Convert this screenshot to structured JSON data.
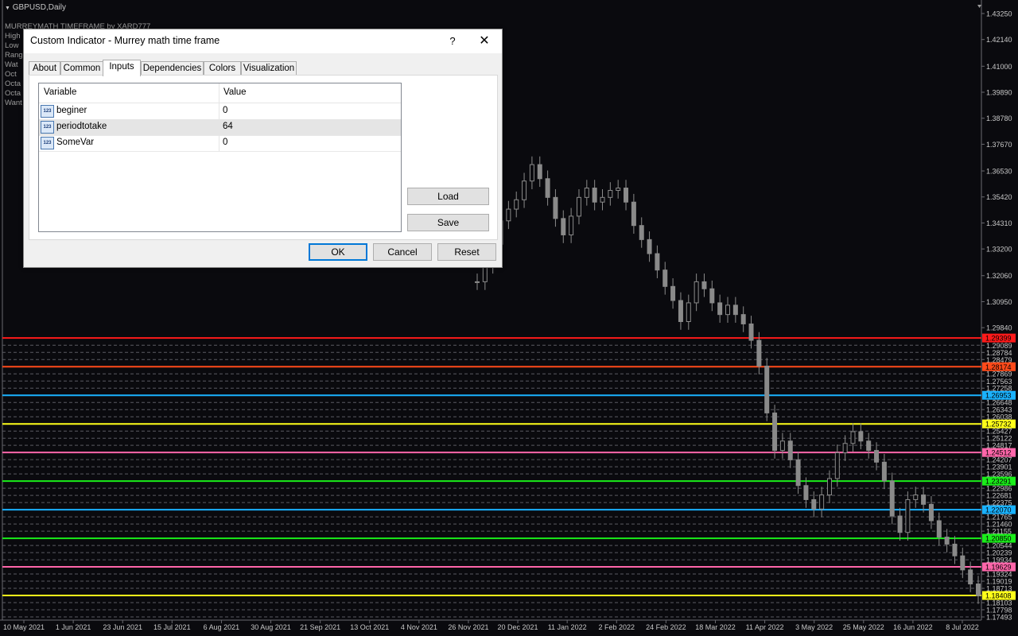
{
  "chart": {
    "title": "GBPUSD,Daily",
    "indicator_labels": [
      "MURREYMATH TIMEFRAME by XARD777",
      "High",
      "Low",
      "Range",
      "Wat",
      "Oct",
      "Octa",
      "Octa",
      "Want"
    ],
    "price_labels": [
      "1.43250",
      "1.42140",
      "1.41000",
      "1.39890",
      "1.38780",
      "1.37670",
      "1.36530",
      "1.35420",
      "1.34310",
      "1.33200",
      "1.32060",
      "1.30950",
      "1.29840",
      "1.29089",
      "1.28784",
      "1.28479",
      "1.27869",
      "1.27563",
      "1.27258",
      "1.26648",
      "1.26343",
      "1.26038",
      "1.25427",
      "1.25122",
      "1.24817",
      "1.24207",
      "1.23901",
      "1.23596",
      "1.22986",
      "1.22681",
      "1.22375",
      "1.21765",
      "1.21460",
      "1.21155",
      "1.20544",
      "1.20239",
      "1.19934",
      "1.19324",
      "1.19019",
      "1.18713",
      "1.18103",
      "1.17798",
      "1.17493"
    ],
    "level_labels": [
      {
        "value": "1.29399",
        "color": "#ff1a1a"
      },
      {
        "value": "1.28174",
        "color": "#ff4a1a"
      },
      {
        "value": "1.26953",
        "color": "#1ab2ff"
      },
      {
        "value": "1.25732",
        "color": "#ffff1a"
      },
      {
        "value": "1.24512",
        "color": "#ff66aa"
      },
      {
        "value": "1.23291",
        "color": "#1aee1a"
      },
      {
        "value": "1.22070",
        "color": "#1ab2ff"
      },
      {
        "value": "1.20850",
        "color": "#1aee1a"
      },
      {
        "value": "1.19629",
        "color": "#ff66aa"
      },
      {
        "value": "1.18408",
        "color": "#ffff1a"
      }
    ],
    "date_labels": [
      "10 May 2021",
      "1 Jun 2021",
      "23 Jun 2021",
      "15 Jul 2021",
      "6 Aug 2021",
      "30 Aug 2021",
      "21 Sep 2021",
      "13 Oct 2021",
      "4 Nov 2021",
      "26 Nov 2021",
      "20 Dec 2021",
      "11 Jan 2022",
      "2 Feb 2022",
      "24 Feb 2022",
      "18 Mar 2022",
      "11 Apr 2022",
      "3 May 2022",
      "25 May 2022",
      "16 Jun 2022",
      "8 Jul 2022"
    ],
    "price_series": [
      1.318,
      1.325,
      1.334,
      1.344,
      1.349,
      1.353,
      1.361,
      1.368,
      1.362,
      1.354,
      1.345,
      1.338,
      1.346,
      1.354,
      1.358,
      1.352,
      1.354,
      1.357,
      1.358,
      1.352,
      1.342,
      1.336,
      1.33,
      1.323,
      1.316,
      1.31,
      1.301,
      1.309,
      1.318,
      1.315,
      1.309,
      1.304,
      1.308,
      1.304,
      1.3,
      1.293,
      1.282,
      1.262,
      1.246,
      1.25,
      1.242,
      1.231,
      1.225,
      1.221,
      1.227,
      1.234,
      1.245,
      1.249,
      1.254,
      1.25,
      1.246,
      1.241,
      1.233,
      1.218,
      1.211,
      1.225,
      1.227,
      1.223,
      1.216,
      1.209,
      1.206,
      1.201,
      1.195,
      1.189,
      1.184
    ],
    "colors": {
      "background": "#0a0a0e",
      "candle": "#8a8a8a",
      "dashed": "#5a5a62"
    }
  },
  "dialog": {
    "title": "Custom Indicator - Murrey math time frame",
    "help_label": "?",
    "close_label": "✕",
    "tabs": [
      {
        "label": "About",
        "active": false
      },
      {
        "label": "Common",
        "active": false
      },
      {
        "label": "Inputs",
        "active": true
      },
      {
        "label": "Dependencies",
        "active": false
      },
      {
        "label": "Colors",
        "active": false
      },
      {
        "label": "Visualization",
        "active": false
      }
    ],
    "grid": {
      "col_variable": "Variable",
      "col_value": "Value",
      "rows": [
        {
          "icon": "123",
          "name": "beginer",
          "value": "0",
          "selected": false
        },
        {
          "icon": "123",
          "name": "periodtotake",
          "value": "64",
          "selected": true
        },
        {
          "icon": "123",
          "name": "SomeVar",
          "value": "0",
          "selected": false
        }
      ]
    },
    "load_label": "Load",
    "save_label": "Save",
    "ok_label": "OK",
    "cancel_label": "Cancel",
    "reset_label": "Reset"
  }
}
